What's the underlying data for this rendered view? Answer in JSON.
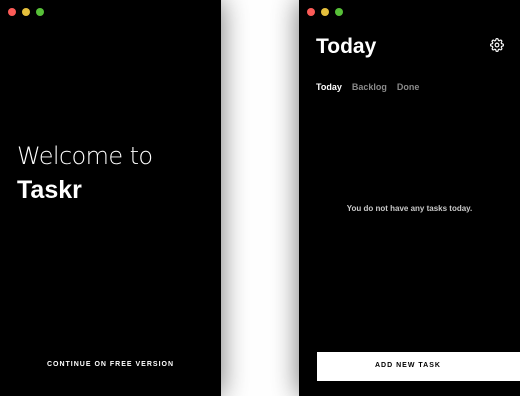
{
  "colors": {
    "window_bg": "#000000",
    "page_bg": "#ffffff",
    "text_primary": "#ffffff",
    "text_muted": "#8a8a8a",
    "traffic_close": "#fc5b57",
    "traffic_minimize": "#e5bf3c",
    "traffic_maximize": "#57c038"
  },
  "onboarding_window": {
    "welcome_line": "Welcome to",
    "app_name": "Taskr",
    "continue_label": "CONTINUE ON FREE VERSION"
  },
  "main_window": {
    "title": "Today",
    "settings_icon": "gear-icon",
    "tabs": [
      {
        "label": "Today",
        "active": true
      },
      {
        "label": "Backlog",
        "active": false
      },
      {
        "label": "Done",
        "active": false
      }
    ],
    "empty_message": "You do not have any tasks today.",
    "add_task_label": "ADD NEW TASK"
  }
}
